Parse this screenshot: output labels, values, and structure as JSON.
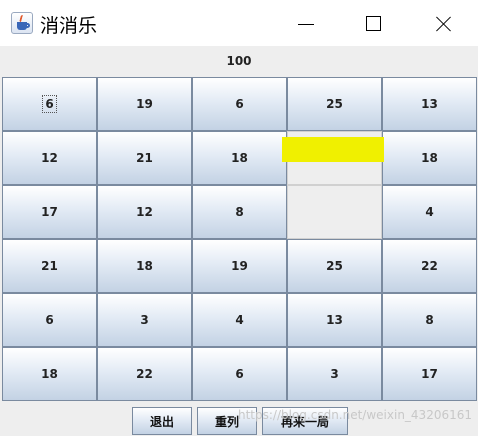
{
  "window": {
    "title": "消消乐"
  },
  "score": "100",
  "board": {
    "rows": [
      [
        "6",
        "19",
        "6",
        "25",
        "13"
      ],
      [
        "12",
        "21",
        "18",
        "",
        "18"
      ],
      [
        "17",
        "12",
        "8",
        "",
        "4"
      ],
      [
        "21",
        "18",
        "19",
        "25",
        "22"
      ],
      [
        "6",
        "3",
        "4",
        "13",
        "8"
      ],
      [
        "18",
        "22",
        "6",
        "3",
        "17"
      ]
    ],
    "empty_cells": [
      [
        1,
        3
      ],
      [
        2,
        3
      ]
    ],
    "focused_cell": [
      0,
      0
    ],
    "highlight_color": "#f0f000"
  },
  "controls": {
    "exit_label": "退出",
    "shuffle_label": "重列",
    "restart_label": "再来一局"
  },
  "watermark": "https://blog.csdn.net/weixin_43206161",
  "icons": [
    "java-cup-icon",
    "minimize-icon",
    "maximize-icon",
    "close-icon"
  ]
}
